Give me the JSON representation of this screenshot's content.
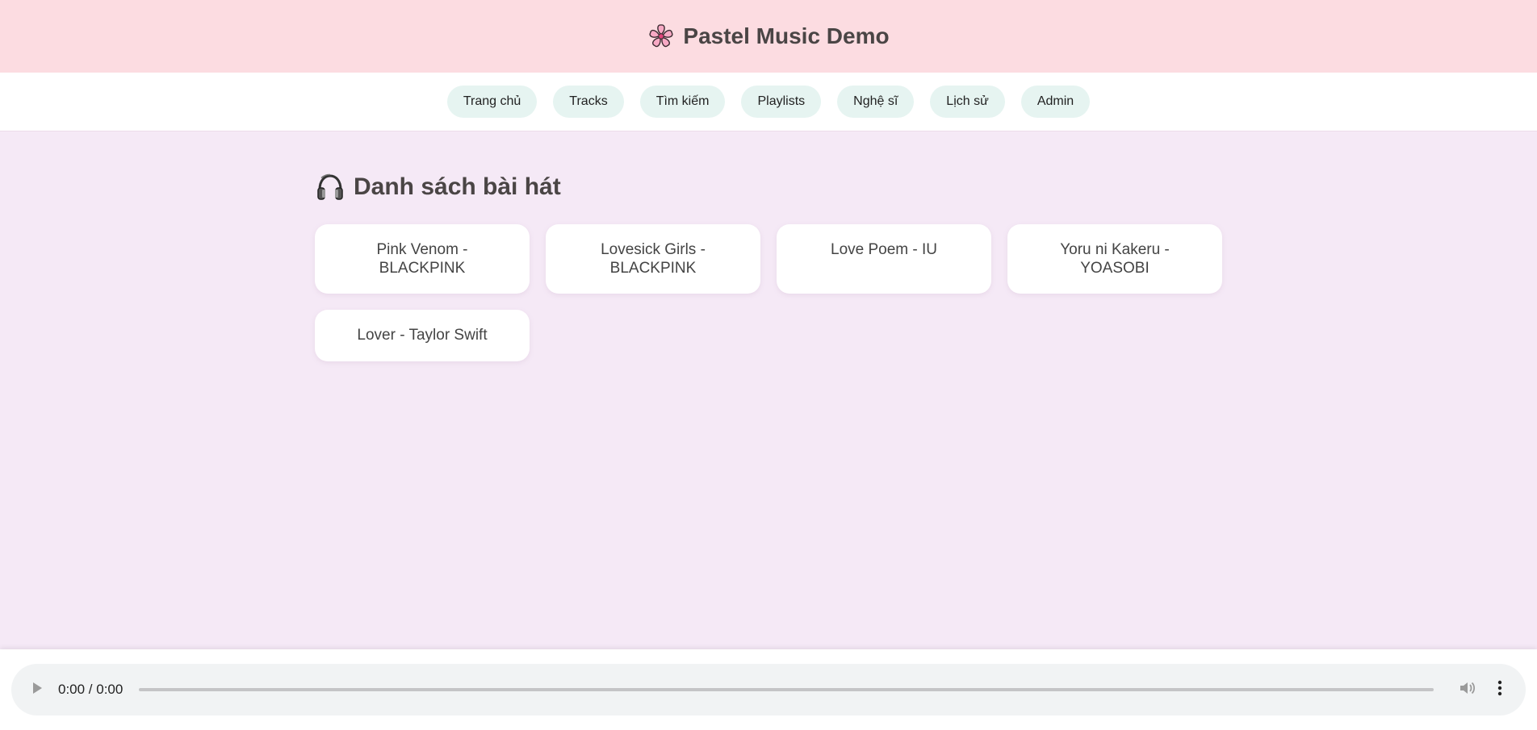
{
  "header": {
    "title": "Pastel Music Demo",
    "logo_icon": "cherry-blossom-icon",
    "background": "#fcdce1"
  },
  "nav": {
    "items": [
      {
        "label": "Trang chủ"
      },
      {
        "label": "Tracks"
      },
      {
        "label": "Tìm kiếm"
      },
      {
        "label": "Playlists"
      },
      {
        "label": "Nghệ sĩ"
      },
      {
        "label": "Lịch sử"
      },
      {
        "label": "Admin"
      }
    ],
    "pill_color": "#e6f4f1"
  },
  "main": {
    "heading": "Danh sách bài hát",
    "heading_icon": "headphones-icon",
    "background": "#f5e9f6",
    "tracks": [
      {
        "label": "Pink Venom - BLACKPINK"
      },
      {
        "label": "Lovesick Girls - BLACKPINK"
      },
      {
        "label": "Love Poem - IU"
      },
      {
        "label": "Yoru ni Kakeru - YOASOBI"
      },
      {
        "label": "Lover - Taylor Swift"
      }
    ]
  },
  "player": {
    "time": "0:00 / 0:00",
    "play_icon": "play-icon",
    "volume_icon": "volume-icon",
    "more_icon": "more-vertical-icon"
  }
}
